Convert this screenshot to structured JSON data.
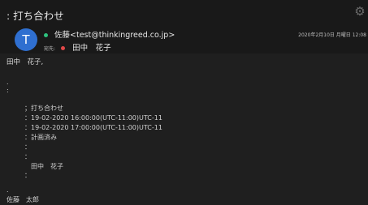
{
  "message": {
    "subject": ": 打ち合わせ",
    "avatar_letter": "T",
    "sender": "佐藤<test@thinkingreed.co.jp>",
    "to_label": "宛先:",
    "to_name": "田中　花子",
    "date": "2020年2月10日 月曜日 12:08"
  },
  "body_lines": [
    "田中　花子,",
    ".",
    ":",
    "；打ち合わせ",
    "：19-02-2020 16:00:00(UTC-11:00)UTC-11",
    "：19-02-2020 17:00:00(UTC-11:00)UTC-11",
    "：計画済み",
    "：",
    "：",
    "田中　花子",
    "：",
    ".",
    "佐藤　太郎"
  ],
  "colors": {
    "avatar": "#2f6fd0",
    "sender_status": "#2ec27e",
    "recipient_status": "#e04848"
  },
  "icons": {
    "settings": "gear-icon"
  }
}
